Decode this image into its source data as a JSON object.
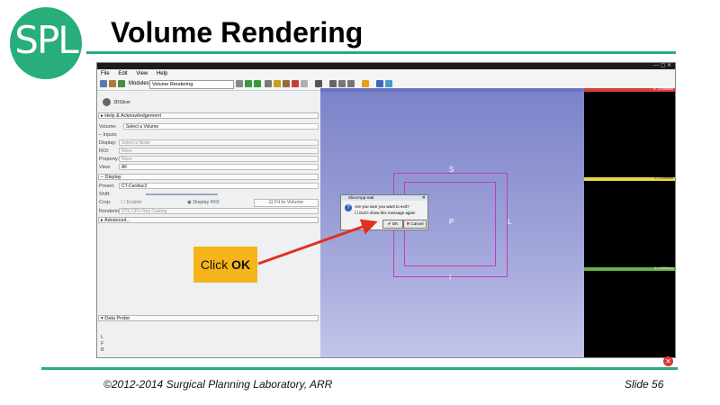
{
  "slide": {
    "logo_text": "SPL",
    "title": "Volume Rendering",
    "footer": "©2012-2014 Surgical Planning Laboratory, ARR",
    "slide_number": "Slide 56",
    "accent_color": "#27ae7a"
  },
  "app": {
    "menu": [
      "File",
      "Edit",
      "View",
      "Help"
    ],
    "modules_label": "Modules:",
    "module_selected": "Volume Rendering",
    "logo_text": "3DSlicer"
  },
  "panel": {
    "help_section": "Help & Acknowledgement",
    "volume_label": "Volume:",
    "volume_value": "Select a Volume",
    "inputs_section": "Inputs",
    "display_label": "Display:",
    "display_value": "Select a Node",
    "roi_label": "ROI:",
    "roi_value": "None",
    "property_label": "Property:",
    "property_value": "None",
    "view_label": "View:",
    "view_value": "All",
    "display_section": "Display",
    "preset_label": "Preset:",
    "preset_value": "CT-Cardiac3",
    "shift_label": "Shift:",
    "crop_label": "Crop:",
    "enable_label": "Enable",
    "display_roi_label": "Display ROI",
    "fit_to_volume_label": "Fit to Volume",
    "rendering_label": "Rendering:",
    "rendering_value": "VTK CPU Ray Casting",
    "advanced_section": "Advanced...",
    "data_probe_section": "Data Probe",
    "probe_letters": [
      "L",
      "F",
      "B"
    ]
  },
  "view3d": {
    "orientation": {
      "top": "S",
      "left": "P",
      "right": "L",
      "bottom": "I"
    }
  },
  "slices": {
    "red_label": "R: -4.0000mm",
    "yellow_label": "S: 0.0000mm",
    "green_label": "A: 0.0000mm"
  },
  "dialog": {
    "title": "SlicerApp-real",
    "message": "Are you sure you want to exit?",
    "checkbox_label": "Don't show this message again",
    "ok_label": "OK",
    "cancel_label": "Cancel"
  },
  "callout": {
    "prefix": "Click ",
    "emphasis": "OK",
    "color": "#f5b51a",
    "arrow_color": "#e1301f"
  }
}
